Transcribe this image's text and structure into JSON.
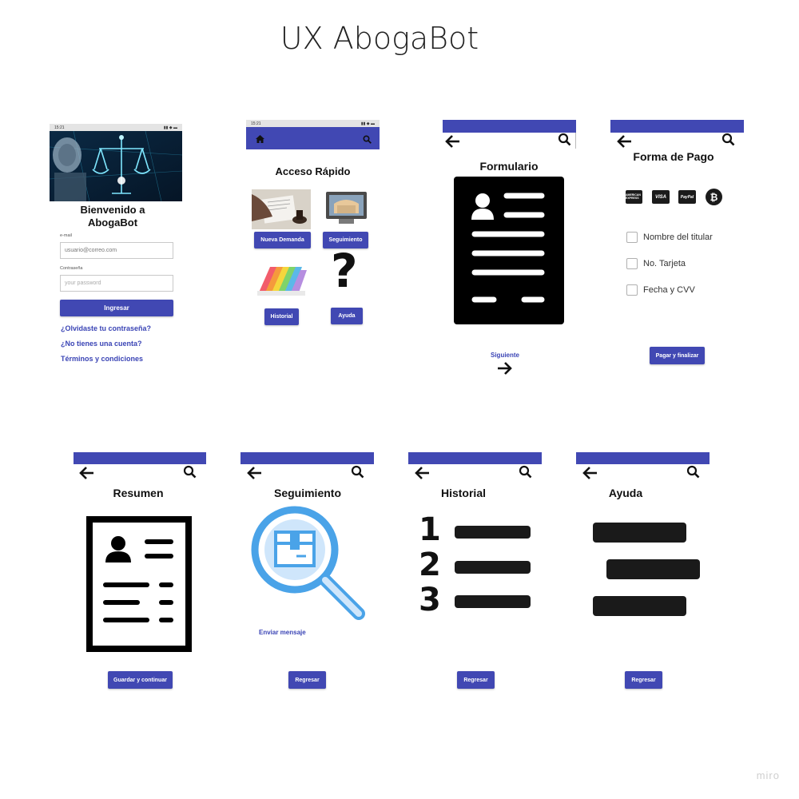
{
  "board": {
    "title": "UX AbogaBot",
    "watermark": "miro"
  },
  "login": {
    "status_time": "15:21",
    "heading_line1": "Bienvenido a",
    "heading_line2": "AbogaBot",
    "email_label": "e-mail",
    "email_placeholder": "usuario@correo.com",
    "password_label": "Contraseña",
    "password_placeholder": "your password",
    "submit_label": "Ingresar",
    "forgot_link": "¿Olvidaste tu contraseña?",
    "register_link": "¿No tienes una cuenta?",
    "terms_link": "Términos y condiciones"
  },
  "quick_access": {
    "status_time": "15:21",
    "title": "Acceso Rápido",
    "buttons": {
      "new_claim": "Nueva Demanda",
      "tracking": "Seguimiento",
      "history": "Historial",
      "help": "Ayuda"
    }
  },
  "form": {
    "title": "Formulario",
    "next_label": "Siguiente"
  },
  "payment": {
    "title": "Forma de Pago",
    "cards": [
      "AMERICAN EXPRESS",
      "VISA",
      "PayPal",
      "₿"
    ],
    "fields": [
      "Nombre del titular",
      "No. Tarjeta",
      "Fecha y CVV"
    ],
    "submit_label": "Pagar y finalizar"
  },
  "summary": {
    "title": "Resumen",
    "button_label": "Guardar y continuar"
  },
  "tracking": {
    "title": "Seguimiento",
    "send_message": "Enviar mensaje",
    "button_label": "Regresar"
  },
  "history": {
    "title": "Historial",
    "numbers": [
      "1",
      "2",
      "3"
    ],
    "button_label": "Regresar"
  },
  "help": {
    "title": "Ayuda",
    "button_label": "Regresar"
  },
  "colors": {
    "accent": "#4148b3",
    "dark": "#1a1a1a",
    "magnifier": "#4aa3e8"
  }
}
